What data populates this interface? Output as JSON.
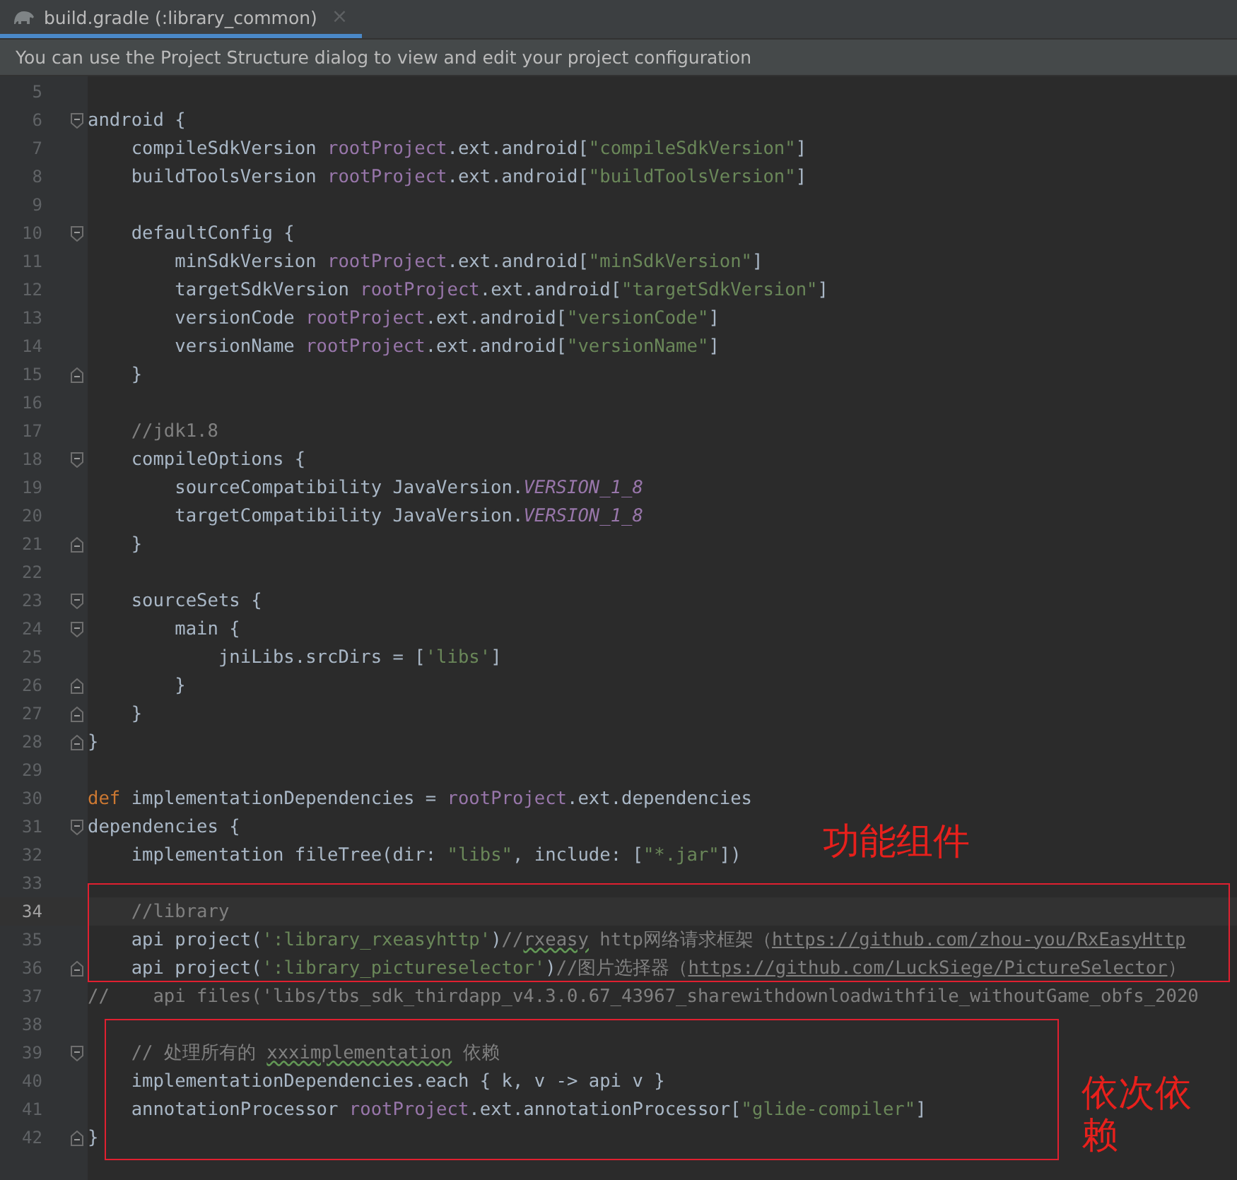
{
  "tab": {
    "label": "build.gradle (:library_common)",
    "selected": true,
    "close": "×"
  },
  "notice": "You can use the Project Structure dialog to view and edit your project configuration",
  "editor": {
    "lines": [
      {
        "number": "5"
      },
      {
        "number": "6",
        "kind": "block_start",
        "tokens": [
          {
            "kind": "plain",
            "text": "android {"
          }
        ]
      },
      {
        "number": "7",
        "tokens": [
          {
            "kind": "plain",
            "text": "    compileSdkVersion "
          },
          {
            "kind": "prop",
            "text": "rootProject"
          },
          {
            "kind": "plain",
            "text": ".ext.android["
          },
          {
            "kind": "str",
            "text": "\"compileSdkVersion\""
          },
          {
            "kind": "plain",
            "text": "]"
          }
        ]
      },
      {
        "number": "8",
        "tokens": [
          {
            "kind": "plain",
            "text": "    buildToolsVersion "
          },
          {
            "kind": "prop",
            "text": "rootProject"
          },
          {
            "kind": "plain",
            "text": ".ext.android["
          },
          {
            "kind": "str",
            "text": "\"buildToolsVersion\""
          },
          {
            "kind": "plain",
            "text": "]"
          }
        ]
      },
      {
        "number": "9"
      },
      {
        "number": "10",
        "kind": "block_start",
        "tokens": [
          {
            "kind": "plain",
            "text": "    defaultConfig {"
          }
        ]
      },
      {
        "number": "11",
        "tokens": [
          {
            "kind": "plain",
            "text": "        minSdkVersion "
          },
          {
            "kind": "prop",
            "text": "rootProject"
          },
          {
            "kind": "plain",
            "text": ".ext.android["
          },
          {
            "kind": "str",
            "text": "\"minSdkVersion\""
          },
          {
            "kind": "plain",
            "text": "]"
          }
        ]
      },
      {
        "number": "12",
        "tokens": [
          {
            "kind": "plain",
            "text": "        targetSdkVersion "
          },
          {
            "kind": "prop",
            "text": "rootProject"
          },
          {
            "kind": "plain",
            "text": ".ext.android["
          },
          {
            "kind": "str",
            "text": "\"targetSdkVersion\""
          },
          {
            "kind": "plain",
            "text": "]"
          }
        ]
      },
      {
        "number": "13",
        "tokens": [
          {
            "kind": "plain",
            "text": "        versionCode "
          },
          {
            "kind": "prop",
            "text": "rootProject"
          },
          {
            "kind": "plain",
            "text": ".ext.android["
          },
          {
            "kind": "str",
            "text": "\"versionCode\""
          },
          {
            "kind": "plain",
            "text": "]"
          }
        ]
      },
      {
        "number": "14",
        "tokens": [
          {
            "kind": "plain",
            "text": "        versionName "
          },
          {
            "kind": "prop",
            "text": "rootProject"
          },
          {
            "kind": "plain",
            "text": ".ext.android["
          },
          {
            "kind": "str",
            "text": "\"versionName\""
          },
          {
            "kind": "plain",
            "text": "]"
          }
        ]
      },
      {
        "number": "15",
        "kind": "block_end",
        "tokens": [
          {
            "kind": "plain",
            "text": "    }"
          }
        ]
      },
      {
        "number": "16"
      },
      {
        "number": "17",
        "tokens": [
          {
            "kind": "comment",
            "text": "    //jdk1.8"
          }
        ]
      },
      {
        "number": "18",
        "kind": "block_start",
        "tokens": [
          {
            "kind": "plain",
            "text": "    compileOptions {"
          }
        ]
      },
      {
        "number": "19",
        "tokens": [
          {
            "kind": "plain",
            "text": "        sourceCompatibility JavaVersion."
          },
          {
            "kind": "const",
            "text": "VERSION_1_8"
          }
        ]
      },
      {
        "number": "20",
        "tokens": [
          {
            "kind": "plain",
            "text": "        targetCompatibility JavaVersion."
          },
          {
            "kind": "const",
            "text": "VERSION_1_8"
          }
        ]
      },
      {
        "number": "21",
        "kind": "block_end",
        "tokens": [
          {
            "kind": "plain",
            "text": "    }"
          }
        ]
      },
      {
        "number": "22"
      },
      {
        "number": "23",
        "kind": "block_start",
        "tokens": [
          {
            "kind": "plain",
            "text": "    sourceSets {"
          }
        ]
      },
      {
        "number": "24",
        "kind": "block_start",
        "tokens": [
          {
            "kind": "plain",
            "text": "        main {"
          }
        ]
      },
      {
        "number": "25",
        "tokens": [
          {
            "kind": "plain",
            "text": "            jniLibs.srcDirs = ["
          },
          {
            "kind": "str",
            "text": "'libs'"
          },
          {
            "kind": "plain",
            "text": "]"
          }
        ]
      },
      {
        "number": "26",
        "kind": "block_end",
        "tokens": [
          {
            "kind": "plain",
            "text": "        }"
          }
        ]
      },
      {
        "number": "27",
        "kind": "block_end",
        "tokens": [
          {
            "kind": "plain",
            "text": "    }"
          }
        ]
      },
      {
        "number": "28",
        "kind": "block_end",
        "tokens": [
          {
            "kind": "plain",
            "text": "}"
          }
        ]
      },
      {
        "number": "29"
      },
      {
        "number": "30",
        "tokens": [
          {
            "kind": "kw",
            "text": "def"
          },
          {
            "kind": "plain",
            "text": " implementationDependencies = "
          },
          {
            "kind": "prop",
            "text": "rootProject"
          },
          {
            "kind": "plain",
            "text": ".ext.dependencies"
          }
        ]
      },
      {
        "number": "31",
        "kind": "block_start",
        "tokens": [
          {
            "kind": "plain",
            "text": "dependencies {"
          }
        ]
      },
      {
        "number": "32",
        "tokens": [
          {
            "kind": "plain",
            "text": "    implementation fileTree(dir: "
          },
          {
            "kind": "str",
            "text": "\"libs\""
          },
          {
            "kind": "plain",
            "text": ", include: ["
          },
          {
            "kind": "str",
            "text": "\"*.jar\""
          },
          {
            "kind": "plain",
            "text": "])"
          }
        ]
      },
      {
        "number": "33"
      },
      {
        "number": "34",
        "current": true,
        "tokens": [
          {
            "kind": "comment",
            "text": "    //library"
          }
        ]
      },
      {
        "number": "35",
        "tokens": [
          {
            "kind": "plain",
            "text": "    api project("
          },
          {
            "kind": "str",
            "text": "':library_rxeasyhttp'"
          },
          {
            "kind": "plain",
            "text": ")"
          },
          {
            "kind": "comment",
            "text": "//"
          },
          {
            "kind": "typo",
            "text": "rxeasy"
          },
          {
            "kind": "comment",
            "text": " http网络请求框架（"
          },
          {
            "kind": "link",
            "text": "https://github.com/zhou-you/RxEasyHttp"
          }
        ]
      },
      {
        "number": "36",
        "kind": "block_end",
        "tokens": [
          {
            "kind": "plain",
            "text": "    api project("
          },
          {
            "kind": "str",
            "text": "':library_pictureselector'"
          },
          {
            "kind": "plain",
            "text": ")"
          },
          {
            "kind": "comment",
            "text": "//图片选择器（"
          },
          {
            "kind": "link",
            "text": "https://github.com/LuckSiege/PictureSelector"
          },
          {
            "kind": "comment",
            "text": "）"
          }
        ]
      },
      {
        "number": "37",
        "tokens": [
          {
            "kind": "comment",
            "text": "//    api files('libs/tbs_sdk_thirdapp_v4.3.0.67_43967_sharewithdownloadwithfile_withoutGame_obfs_2020"
          }
        ]
      },
      {
        "number": "38"
      },
      {
        "number": "39",
        "kind": "block_start",
        "tokens": [
          {
            "kind": "comment",
            "text": "    // 处理所有的 "
          },
          {
            "kind": "typo",
            "text": "xxximplementation"
          },
          {
            "kind": "comment",
            "text": " 依赖"
          }
        ]
      },
      {
        "number": "40",
        "tokens": [
          {
            "kind": "plain",
            "text": "    implementationDependencies.each { k, v -> api v }"
          }
        ]
      },
      {
        "number": "41",
        "tokens": [
          {
            "kind": "plain",
            "text": "    annotationProcessor "
          },
          {
            "kind": "prop",
            "text": "rootProject"
          },
          {
            "kind": "plain",
            "text": ".ext.annotationProcessor["
          },
          {
            "kind": "str",
            "text": "\"glide-compiler\""
          },
          {
            "kind": "plain",
            "text": "]"
          }
        ]
      },
      {
        "number": "42",
        "kind": "block_end",
        "tokens": [
          {
            "kind": "plain",
            "text": "}"
          }
        ]
      }
    ]
  },
  "annotations": [
    {
      "text": "功能组件",
      "kind": "top"
    },
    {
      "text": "依次依赖",
      "kind": "bottom"
    }
  ]
}
